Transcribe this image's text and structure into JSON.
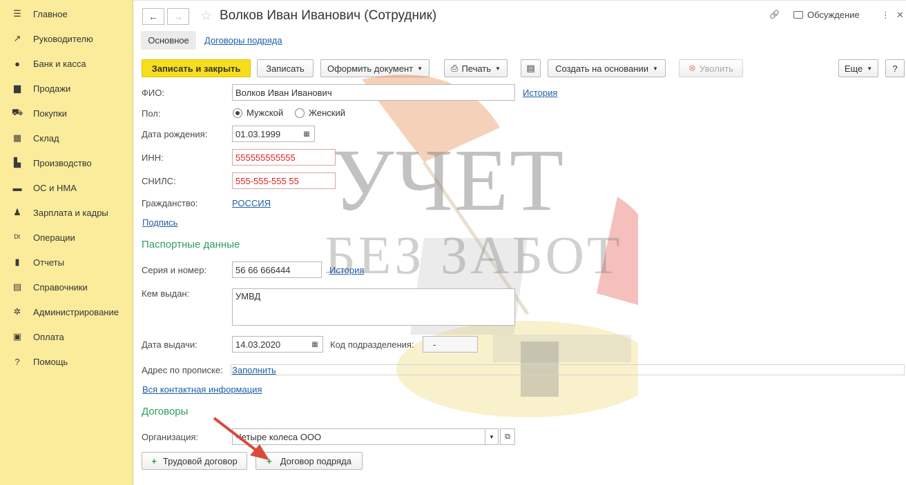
{
  "sidebar": {
    "items": [
      {
        "label": "Главное",
        "icon": "menu-icon",
        "glyph": "☰"
      },
      {
        "label": "Руководителю",
        "icon": "trend-icon",
        "glyph": "↗"
      },
      {
        "label": "Банк и касса",
        "icon": "coin-icon",
        "glyph": "●"
      },
      {
        "label": "Продажи",
        "icon": "bag-icon",
        "glyph": "▆"
      },
      {
        "label": "Покупки",
        "icon": "cart-icon",
        "glyph": "⛟"
      },
      {
        "label": "Склад",
        "icon": "warehouse-icon",
        "glyph": "▦"
      },
      {
        "label": "Производство",
        "icon": "factory-icon",
        "glyph": "▙"
      },
      {
        "label": "ОС и НМА",
        "icon": "truck-icon",
        "glyph": "▬"
      },
      {
        "label": "Зарплата и кадры",
        "icon": "person-icon",
        "glyph": "♟"
      },
      {
        "label": "Операции",
        "icon": "debit-credit-icon",
        "glyph": "ᴰᵗ"
      },
      {
        "label": "Отчеты",
        "icon": "bar-chart-icon",
        "glyph": "▮"
      },
      {
        "label": "Справочники",
        "icon": "book-icon",
        "glyph": "▤"
      },
      {
        "label": "Администрирование",
        "icon": "gear-icon",
        "glyph": "✲"
      },
      {
        "label": "Оплата",
        "icon": "wallet-icon",
        "glyph": "▣"
      },
      {
        "label": "Помощь",
        "icon": "help-icon",
        "glyph": "?"
      }
    ]
  },
  "header": {
    "back_glyph": "←",
    "forward_glyph": "→",
    "star_glyph": "☆",
    "title": "Волков Иван Иванович (Сотрудник)",
    "link_glyph": "🔗",
    "discussion_label": "Обсуждение",
    "more_glyph": "⋮",
    "close_glyph": "✕"
  },
  "tabs": {
    "main": "Основное",
    "contracts": "Договоры подряда"
  },
  "toolbar": {
    "save_close": "Записать и закрыть",
    "save": "Записать",
    "issue_doc": "Оформить документ",
    "print": "Печать",
    "print_glyph": "⎙",
    "list_glyph": "▤",
    "create_based": "Создать на основании",
    "dismiss": "Уволить",
    "dismiss_glyph": "⊗",
    "more": "Еще",
    "help": "?"
  },
  "form": {
    "fio_label": "ФИО:",
    "fio_value": "Волков Иван Иванович",
    "history": "История",
    "gender_label": "Пол:",
    "gender_male": "Мужской",
    "gender_female": "Женский",
    "birth_label": "Дата рождения:",
    "birth_value": "01.03.1999",
    "inn_label": "ИНН:",
    "inn_value": "555555555555",
    "snils_label": "СНИЛС:",
    "snils_value": "555-555-555 55",
    "citizenship_label": "Гражданство:",
    "citizenship_value": "РОССИЯ",
    "signature_link": "Подпись",
    "passport_section": "Паспортные данные",
    "series_label": "Серия и номер:",
    "series_value": "56 66 666444",
    "series_history": "История",
    "issued_by_label": "Кем выдан:",
    "issued_by_value": "УМВД",
    "issue_date_label": "Дата выдачи:",
    "issue_date_value": "14.03.2020",
    "dept_code_label": "Код подразделения:",
    "dept_code_value": "-",
    "address_label": "Адрес по прописке:",
    "address_link": "Заполнить",
    "contacts_link": "Вся контактная информация",
    "contracts_section": "Договоры",
    "org_label": "Организация:",
    "org_value": "Четыре колеса ООО",
    "labor_contract": "Трудовой договор",
    "work_contract": "Договор подряда",
    "plus_glyph": "+",
    "calendar_glyph": "▦"
  },
  "watermark": {
    "line1": "УЧЕТ",
    "line2": "БЕЗ ЗАБОТ"
  }
}
